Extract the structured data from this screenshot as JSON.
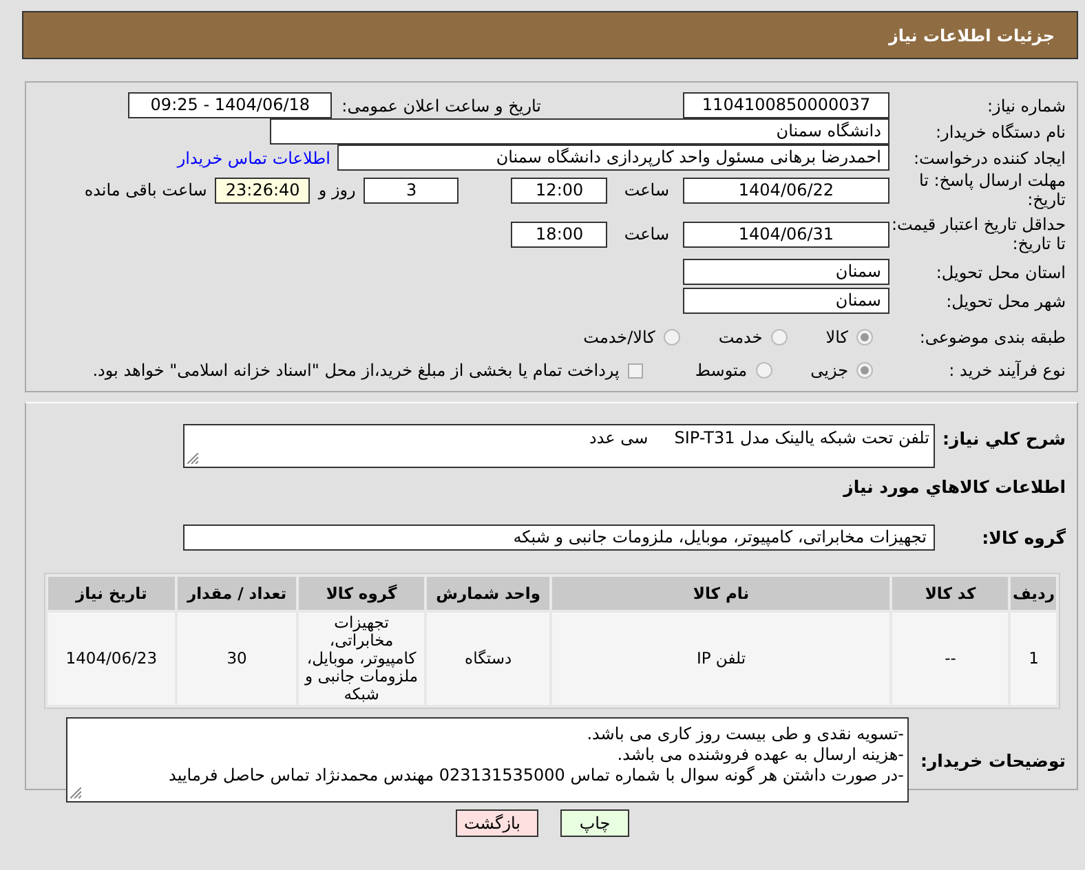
{
  "header": {
    "title": "جزئیات اطلاعات نیاز"
  },
  "need_number": {
    "label": "شماره نیاز:",
    "value": "1104100850000037"
  },
  "announce": {
    "label": "تاریخ و ساعت اعلان عمومی:",
    "value": "1404/06/18 - 09:25"
  },
  "buyer_org": {
    "label": "نام دستگاه خریدار:",
    "value": "دانشگاه سمنان"
  },
  "requester": {
    "label": "ایجاد کننده درخواست:",
    "value": "احمدرضا برهانی مسئول واحد کارپردازی دانشگاه سمنان",
    "link": "اطلاعات تماس خریدار"
  },
  "reply_deadline": {
    "label": "مهلت ارسال پاسخ: تا تاریخ:",
    "date": "1404/06/22",
    "time_label": "ساعت",
    "time": "12:00",
    "days": "3",
    "days_label": "روز و",
    "remaining": "23:26:40",
    "remaining_label": "ساعت باقی مانده"
  },
  "price_validity": {
    "label": "حداقل تاریخ اعتبار قیمت: تا تاریخ:",
    "date": "1404/06/31",
    "time_label": "ساعت",
    "time": "18:00"
  },
  "province": {
    "label": "استان محل تحویل:",
    "value": "سمنان"
  },
  "city": {
    "label": "شهر محل تحویل:",
    "value": "سمنان"
  },
  "category": {
    "label": "طبقه بندی موضوعی:",
    "options": [
      {
        "label": "کالا",
        "selected": true
      },
      {
        "label": "خدمت",
        "selected": false
      },
      {
        "label": "کالا/خدمت",
        "selected": false
      }
    ]
  },
  "purchase_type": {
    "label": "نوع فرآیند خرید :",
    "options": [
      {
        "label": "جزیی",
        "selected": true
      },
      {
        "label": "متوسط",
        "selected": false
      }
    ],
    "treasury": {
      "label": "پرداخت تمام یا بخشی از مبلغ خرید،از محل \"اسناد خزانه اسلامی\" خواهد بود.",
      "checked": false
    }
  },
  "description": {
    "label": "شرح کلي نياز:",
    "value": "تلفن تحت شبکه یالینک مدل SIP-T31     سی عدد"
  },
  "items_heading": "اطلاعات کالاهاي مورد نياز",
  "goods_group": {
    "label": "گروه کالا:",
    "value": "تجهیزات مخابراتی، کامپیوتر، موبایل، ملزومات جانبی و شبکه"
  },
  "table": {
    "columns": [
      "ردیف",
      "کد کالا",
      "نام کالا",
      "واحد شمارش",
      "گروه کالا",
      "تعداد / مقدار",
      "تاریخ نیاز"
    ],
    "rows": [
      [
        "1",
        "--",
        "تلفن IP",
        "دستگاه",
        "تجهیزات مخابراتی، کامپیوتر، موبایل، ملزومات جانبی و شبکه",
        "30",
        "1404/06/23"
      ]
    ]
  },
  "buyer_notes": {
    "label": "توضیحات خریدار:",
    "lines": [
      "-تسویه نقدی و طی بیست روز کاری می باشد.",
      "-هزینه ارسال به عهده فروشنده می باشد.",
      "-در صورت داشتن هر گونه سوال با شماره تماس 023131535000 مهندس محمدنژاد تماس حاصل فرمایید"
    ]
  },
  "buttons": [
    {
      "label": "چاپ",
      "kind": "print"
    },
    {
      "label": "بازگشت",
      "kind": "back"
    }
  ]
}
